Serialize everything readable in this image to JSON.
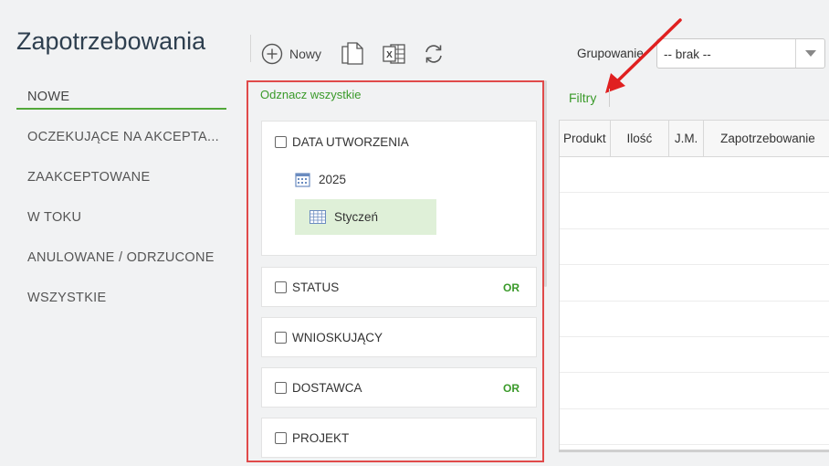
{
  "app": {
    "title": "Zapotrzebowania"
  },
  "nav": {
    "items": [
      {
        "label": "NOWE"
      },
      {
        "label": "OCZEKUJĄCE NA AKCEPTA..."
      },
      {
        "label": "ZAAKCEPTOWANE"
      },
      {
        "label": "W TOKU"
      },
      {
        "label": "ANULOWANE / ODRZUCONE"
      },
      {
        "label": "WSZYSTKIE"
      }
    ]
  },
  "toolbar": {
    "new_label": "Nowy",
    "icons": [
      "plus-circle-icon",
      "copy-document-icon",
      "excel-icon",
      "refresh-icon"
    ]
  },
  "grouping": {
    "label": "Grupowanie",
    "value": "-- brak --"
  },
  "filters": {
    "select_all": "Odznacz wszystkie",
    "link": "Filtry",
    "date": {
      "title": "DATA UTWORZENIA",
      "year": "2025",
      "month": "Styczeń"
    },
    "status": {
      "title": "STATUS",
      "badge": "OR"
    },
    "requester": {
      "title": "WNIOSKUJĄCY"
    },
    "supplier": {
      "title": "DOSTAWCA",
      "badge": "OR"
    },
    "project": {
      "title": "PROJEKT"
    }
  },
  "grid": {
    "columns": [
      "Produkt",
      "Ilość",
      "J.M.",
      "Zapotrzebowanie"
    ]
  },
  "colors": {
    "accent": "#3a9a2a",
    "highlight_border": "#e04a4a",
    "title": "#2e3f4f",
    "selected_month": "#dff0d8"
  }
}
